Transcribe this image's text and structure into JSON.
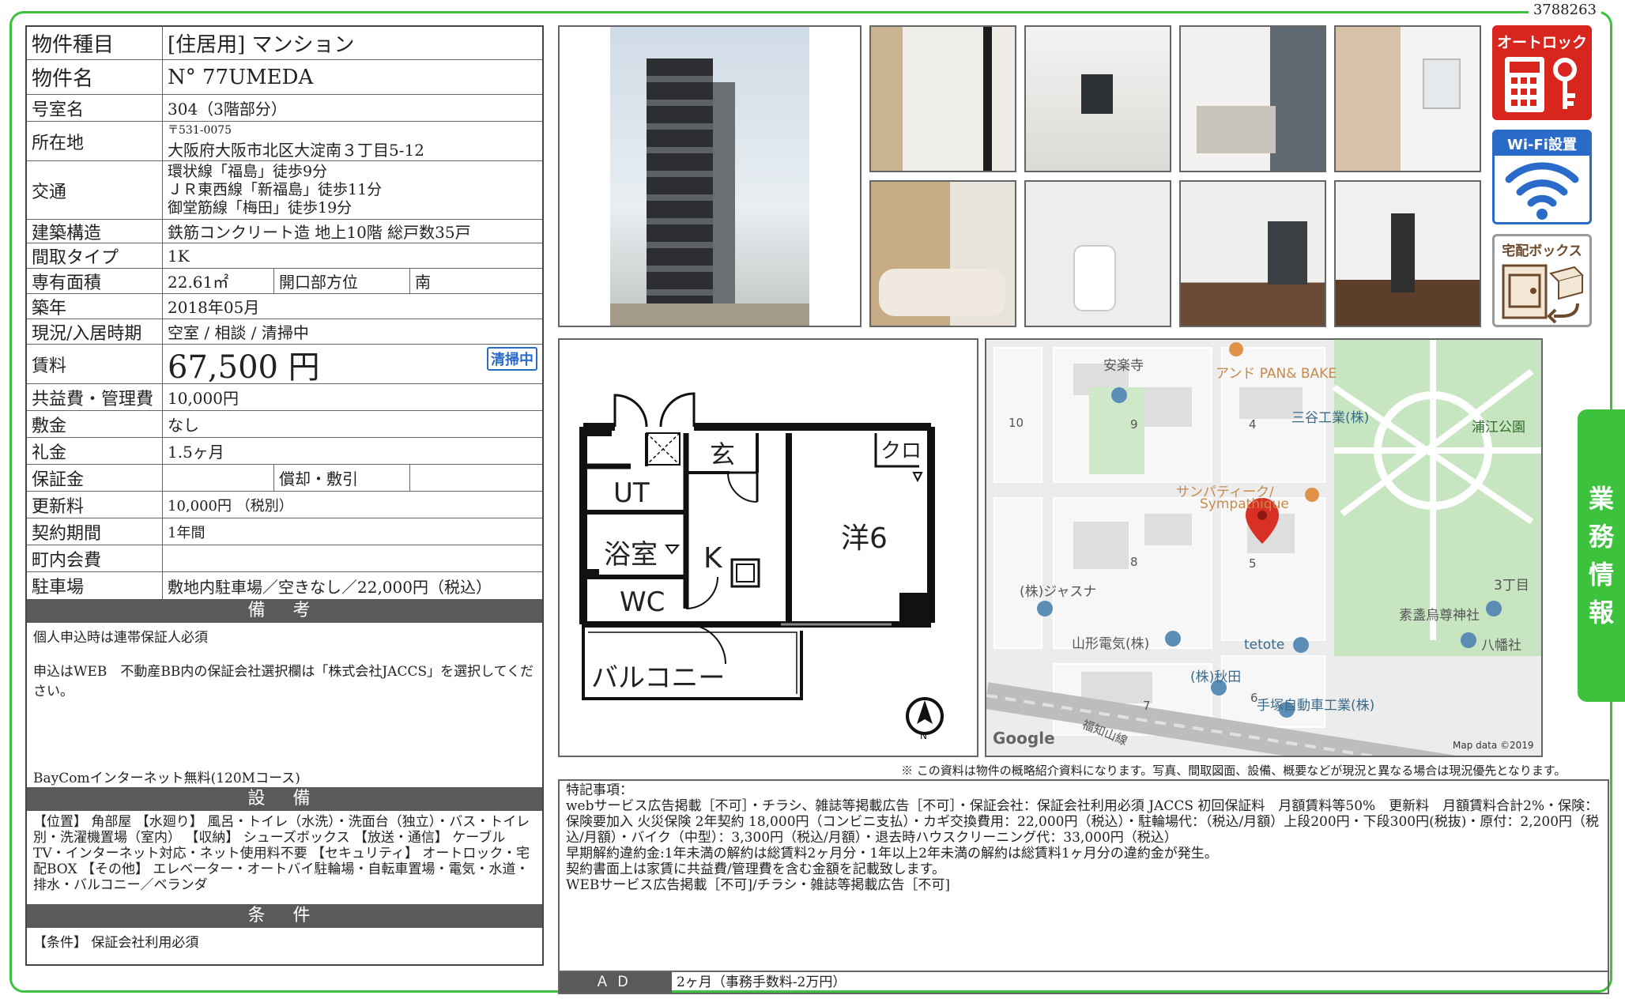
{
  "doc_id": "3788263",
  "spec": {
    "type_label": "物件種目",
    "type_value": "[住居用] マンション",
    "name_label": "物件名",
    "name_value": "N° 77UMEDA",
    "room_label": "号室名",
    "room_value": "304（3階部分）",
    "address_label": "所在地",
    "postal": "〒531-0075",
    "address": "大阪府大阪市北区大淀南３丁目5-12",
    "access_label": "交通",
    "access_lines": [
      "環状線「福島」徒歩9分",
      "ＪＲ東西線「新福島」徒歩11分",
      "御堂筋線「梅田」徒歩19分"
    ],
    "structure_label": "建築構造",
    "structure_value": "鉄筋コンクリート造 地上10階 総戸数35戸",
    "layout_label": "間取タイプ",
    "layout_value": "1K",
    "area_label": "専有面積",
    "area_value": "22.61㎡",
    "facing_label": "開口部方位",
    "facing_value": "南",
    "built_label": "築年",
    "built_value": "2018年05月",
    "status_label": "現況/入居時期",
    "status_value": "空室 / 相談 / 清掃中",
    "rent_label": "賃料",
    "rent_value": "67,500 円",
    "cleaning_badge": "清掃中",
    "fee_label": "共益費・管理費",
    "fee_value": "10,000円",
    "deposit_label": "敷金",
    "deposit_value": "なし",
    "key_money_label": "礼金",
    "key_money_value": "1.5ヶ月",
    "guarantee_label": "保証金",
    "guarantee_value": "",
    "amort_label": "償却・敷引",
    "amort_value": "",
    "renewal_label": "更新料",
    "renewal_value": "10,000円 （税別）",
    "term_label": "契約期間",
    "term_value": "1年間",
    "town_fee_label": "町内会費",
    "town_fee_value": "",
    "parking_label": "駐車場",
    "parking_value": "敷地内駐車場／空きなし／22,000円（税込）"
  },
  "remarks": {
    "header": "備 考",
    "line1": "個人申込時は連帯保証人必須",
    "line2": "申込はWEB　不動産BB内の保証会社選択欄は「株式会社JACCS」を選択してください。",
    "line3": "BayComインターネット無料(120Mコース)"
  },
  "equipment": {
    "header": "設 備",
    "text": "【位置】 角部屋 【水廻り】 風呂・トイレ（水洗）・洗面台（独立）・バス・トイレ別・洗濯機置場（室内） 【収納】 シューズボックス 【放送・通信】 ケーブルTV・インターネット対応・ネット使用料不要 【セキュリティ】 オートロック・宅配BOX 【その他】 エレベーター・オートバイ駐輪場・自転車置場・電気・水道・排水・バルコニー／ベランダ"
  },
  "conditions": {
    "header": "条 件",
    "text": "【条件】 保証会社利用必須"
  },
  "badges": {
    "autolock": "オートロック",
    "wifi": "Wi-Fi設置",
    "delivery": "宅配ボックス"
  },
  "side_tab": [
    "業",
    "務",
    "情",
    "報"
  ],
  "floorplan": {
    "genkan": "玄",
    "closet": "クロ",
    "ut": "UT",
    "bath": "浴室",
    "kitchen": "K",
    "room": "洋6",
    "wc": "WC",
    "balcony": "バルコニー"
  },
  "map": {
    "labels": {
      "anrakuji": "安楽寺",
      "pan": "アンド PAN& BAKE",
      "mitani": "三谷工業(株)",
      "urae": "浦江公園",
      "sympa1": "サンパティーク/",
      "sympa2": "Sympathique",
      "jasuna": "(株)ジャスナ",
      "yamagata": "山形電気(株)",
      "tetote": "tetote",
      "akita": "(株)秋田",
      "tezuka": "手塚自動車工業(株)",
      "sugawara": "素盞烏尊神社",
      "hachiman": "八幡社",
      "chome3": "3丁目",
      "fukuchiyama": "福知山線",
      "google": "Google",
      "mapdata": "Map data ©2019"
    },
    "block_numbers": [
      "10",
      "9",
      "4",
      "8",
      "5",
      "7",
      "6"
    ]
  },
  "disclaimer": "※ この資料は物件の概略紹介資料になります。写真、間取図面、設備、概要などが現況と異なる場合は現況優先となります。",
  "special": {
    "title": "特記事項：",
    "lines": [
      "webサービス広告掲載［不可］・チラシ、雑誌等掲載広告［不可］・保証会社：保証会社利用必須 JACCS 初回保証料　月額賃料等50%　更新料　月額賃料合計2%・保険：保険要加入 火災保険 2年契約 18,000円（コンビニ支払）・カギ交換費用：22,000円（税込）・駐輪場代：（税込/月額）上段200円・下段300円(税抜)・原付：2,200円（税込/月額）・バイク（中型）：3,300円（税込/月額）・退去時ハウスクリーニング代：33,000円（税込）",
      "早期解約違約金:1年未満の解約は総賃料2ヶ月分・1年以上2年未満の解約は総賃料1ヶ月分の違約金が発生。",
      "契約書面上は家賃に共益費/管理費を含む金額を記載致します。",
      "WEBサービス広告掲載［不可]/チラシ・雑誌等掲載広告［不可]"
    ]
  },
  "ad": {
    "label": "ＡＤ",
    "value": "2ヶ月（事務手数料-2万円）"
  },
  "colors": {
    "frame": "#3cc23c",
    "badge_blue": "#2a6ac9",
    "badge_red": "#d8261f",
    "header_gray": "#5a5a5a",
    "map_pin": "#d93025"
  }
}
